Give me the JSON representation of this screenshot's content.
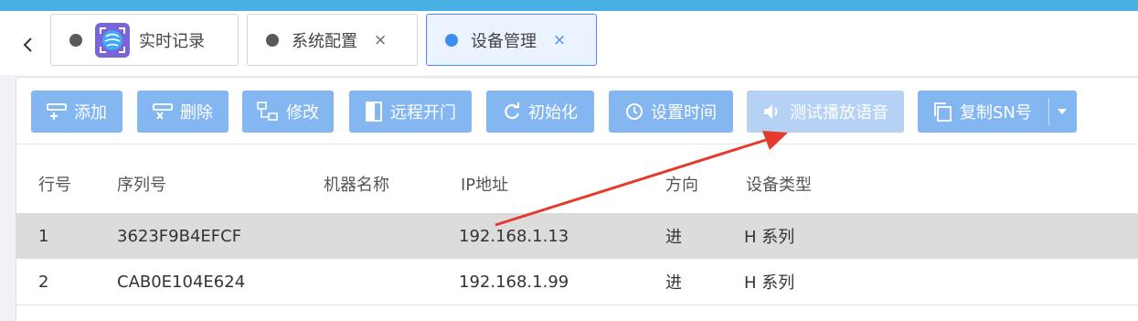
{
  "tabs": [
    {
      "label": "实时记录",
      "closable": false
    },
    {
      "label": "系统配置",
      "closable": true,
      "close": "×"
    },
    {
      "label": "设备管理",
      "closable": true,
      "close": "×",
      "active": true
    }
  ],
  "nav": {
    "back_icon": "chevron-left-icon"
  },
  "toolbar": {
    "add": "添加",
    "delete": "删除",
    "edit": "修改",
    "remote_open": "远程开门",
    "init": "初始化",
    "set_time": "设置时间",
    "test_voice": "测试播放语音",
    "copy_sn": "复制SN号"
  },
  "table": {
    "columns": [
      "行号",
      "序列号",
      "机器名称",
      "IP地址",
      "方向",
      "设备类型"
    ],
    "rows": [
      {
        "no": "1",
        "serial": "3623F9B4EFCF",
        "name": "",
        "ip": "192.168.1.13",
        "direction": "进",
        "type": "H 系列"
      },
      {
        "no": "2",
        "serial": "CAB0E104E624",
        "name": "",
        "ip": "192.168.1.99",
        "direction": "进",
        "type": "H 系列"
      }
    ]
  },
  "colors": {
    "topbar": "#49b0e3",
    "button": "#84b6f2",
    "button_disabled": "#b5d1f3",
    "active_tab_border": "#4a90e2",
    "highlight_row": "#dcdcdc",
    "annotation_arrow": "#e53b2c"
  }
}
